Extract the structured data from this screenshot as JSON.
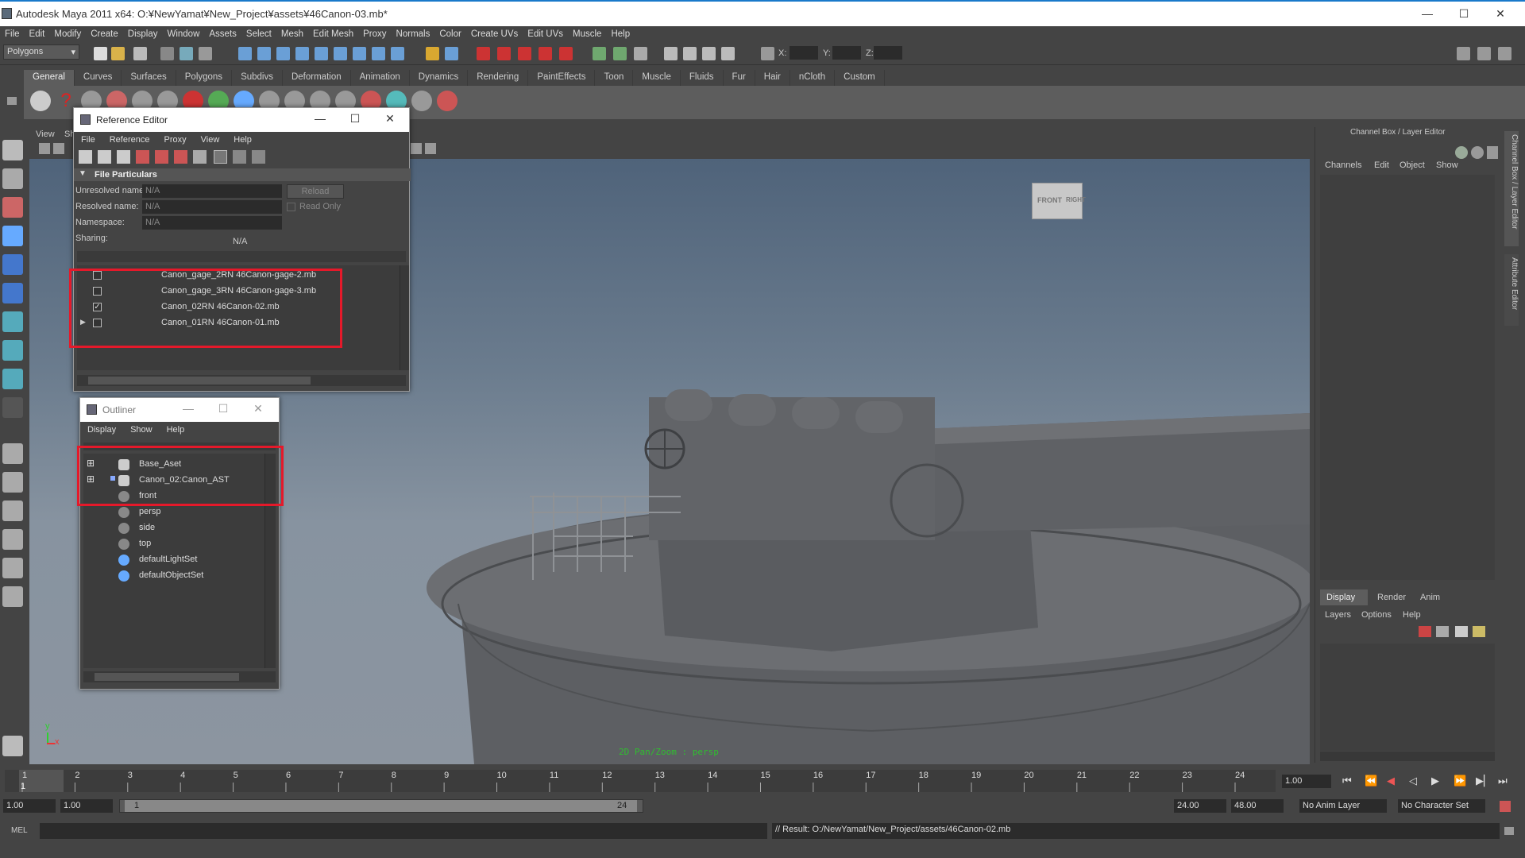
{
  "window": {
    "title": "Autodesk Maya 2011 x64: O:¥NewYamat¥New_Project¥assets¥46Canon-03.mb*",
    "minimize": "—",
    "maximize": "☐",
    "close": "✕"
  },
  "menubar": [
    "File",
    "Edit",
    "Modify",
    "Create",
    "Display",
    "Window",
    "Assets",
    "Select",
    "Mesh",
    "Edit Mesh",
    "Proxy",
    "Normals",
    "Color",
    "Create UVs",
    "Edit UVs",
    "Muscle",
    "Help"
  ],
  "statusline": {
    "mode": "Polygons",
    "x_label": "X:",
    "y_label": "Y:",
    "z_label": "Z:"
  },
  "shelf": {
    "tabs": [
      "General",
      "Curves",
      "Surfaces",
      "Polygons",
      "Subdivs",
      "Deformation",
      "Animation",
      "Dynamics",
      "Rendering",
      "PaintEffects",
      "Toon",
      "Muscle",
      "Fluids",
      "Fur",
      "Hair",
      "nCloth",
      "Custom"
    ],
    "active_tab": "General"
  },
  "viewport": {
    "menu": [
      "View",
      "Sh"
    ],
    "viewcube_front": "FRONT",
    "viewcube_right": "RIGHT",
    "hud_text": "2D Pan/Zoom : persp",
    "axis_y": "y",
    "axis_x": "x"
  },
  "reference_editor": {
    "title": "Reference Editor",
    "menu": [
      "File",
      "Reference",
      "Proxy",
      "View",
      "Help"
    ],
    "section": "File Particulars",
    "unresolved_label": "Unresolved name:",
    "unresolved_value": "N/A",
    "resolved_label": "Resolved name:",
    "resolved_value": "N/A",
    "namespace_label": "Namespace:",
    "namespace_value": "N/A",
    "sharing_label": "Sharing:",
    "sharing_value": "N/A",
    "reload_button": "Reload",
    "read_only_label": "Read Only",
    "references": [
      {
        "name": "Canon_gage_2RN 46Canon-gage-2.mb",
        "checked": false,
        "expander": false
      },
      {
        "name": "Canon_gage_3RN 46Canon-gage-3.mb",
        "checked": false,
        "expander": false
      },
      {
        "name": "Canon_02RN 46Canon-02.mb",
        "checked": true,
        "expander": false
      },
      {
        "name": "Canon_01RN 46Canon-01.mb",
        "checked": false,
        "expander": true
      }
    ]
  },
  "outliner": {
    "title": "Outliner",
    "menu": [
      "Display",
      "Show",
      "Help"
    ],
    "items": [
      {
        "name": "Base_Aset",
        "expander": "⊞",
        "icon": "group-icon"
      },
      {
        "name": "Canon_02:Canon_AST",
        "expander": "⊞",
        "icon": "group-icon"
      },
      {
        "name": "front",
        "expander": "",
        "icon": "camera-icon"
      },
      {
        "name": "persp",
        "expander": "",
        "icon": "camera-icon"
      },
      {
        "name": "side",
        "expander": "",
        "icon": "camera-icon"
      },
      {
        "name": "top",
        "expander": "",
        "icon": "camera-icon"
      },
      {
        "name": "defaultLightSet",
        "expander": "",
        "icon": "set-icon"
      },
      {
        "name": "defaultObjectSet",
        "expander": "",
        "icon": "set-icon"
      }
    ]
  },
  "channel_box": {
    "title": "Channel Box / Layer Editor",
    "menu": [
      "Channels",
      "Edit",
      "Object",
      "Show"
    ],
    "layer_tabs": [
      "Display",
      "Render",
      "Anim"
    ],
    "active_layer_tab": "Display",
    "layer_menu": [
      "Layers",
      "Options",
      "Help"
    ],
    "side_tab_1": "Channel Box / Layer Editor",
    "side_tab_2": "Attribute Editor"
  },
  "timeline": {
    "ticks": [
      "1",
      "2",
      "3",
      "4",
      "5",
      "6",
      "7",
      "8",
      "9",
      "10",
      "11",
      "12",
      "13",
      "14",
      "15",
      "16",
      "17",
      "18",
      "19",
      "20",
      "21",
      "22",
      "23",
      "24"
    ],
    "current_frame_label": "1",
    "current_time": "1.00"
  },
  "range": {
    "start_time": "1.00",
    "start_playback": "1.00",
    "range_start": "1",
    "range_end": "24",
    "end_playback": "24.00",
    "end_time": "48.00",
    "anim_layer": "No Anim Layer",
    "character_set": "No Character Set"
  },
  "command_line": {
    "mel_label": "MEL",
    "result": "// Result: O:/NewYamat/New_Project/assets/46Canon-02.mb"
  }
}
